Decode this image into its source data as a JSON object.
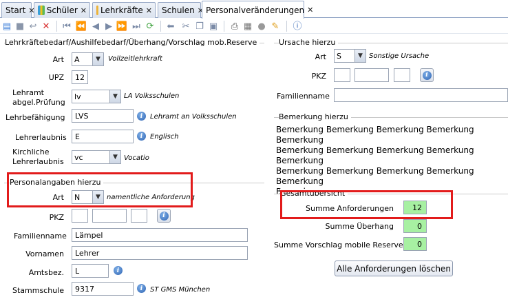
{
  "tabs": [
    {
      "label": "Start",
      "close": "✕"
    },
    {
      "label": "Schüler",
      "close": "✕"
    },
    {
      "label": "Lehrkräfte",
      "close": "✕"
    },
    {
      "label": "Schulen",
      "close": "✕"
    },
    {
      "label": "Personalveränderungen",
      "close": "✕"
    }
  ],
  "toolbar": {
    "icons": [
      "new-icon",
      "save-icon",
      "undo-icon",
      "delete-icon",
      "first-icon",
      "prev-page-icon",
      "prev-icon",
      "next-icon",
      "next-page-icon",
      "last-icon",
      "refresh-icon",
      "back-icon",
      "cut-icon",
      "copy-icon",
      "paste-icon",
      "print-icon",
      "preview-icon",
      "record-icon",
      "clear-icon",
      "help-icon"
    ]
  },
  "left": {
    "legend": "Lehrkräftebedarf/Aushilfebedarf/Überhang/Vorschlag mob.Reserve",
    "art": {
      "label": "Art",
      "value": "A",
      "desc": "Vollzeitlehrkraft"
    },
    "upz": {
      "label": "UPZ",
      "value": "12"
    },
    "lehramt": {
      "label1": "Lehramt",
      "label2": "abgel.Prüfung",
      "value": "lv",
      "desc": "LA Volksschulen"
    },
    "befaehigung": {
      "label": "Lehrbefähigung",
      "value": "LVS",
      "desc": "Lehramt an Volksschulen"
    },
    "erlaubnis": {
      "label": "Lehrerlaubnis",
      "value": "E",
      "desc": "Englisch"
    },
    "kirchlich": {
      "label1": "Kirchliche",
      "label2": "Lehrerlaubnis",
      "value": "vc",
      "desc": "Vocatio"
    }
  },
  "personal": {
    "legend": "Personalangaben hierzu",
    "art": {
      "label": "Art",
      "value": "N",
      "desc": "namentliche Anforderung"
    },
    "pkz": {
      "label": "PKZ"
    },
    "familienname": {
      "label": "Familienname",
      "value": "Lämpel"
    },
    "vornamen": {
      "label": "Vornamen",
      "value": "Lehrer"
    },
    "amtsbez": {
      "label": "Amtsbez.",
      "value": "L"
    },
    "stammschule": {
      "label": "Stammschule",
      "value": "9317",
      "desc": "ST GMS München"
    }
  },
  "ursache": {
    "legend": "Ursache hierzu",
    "art": {
      "label": "Art",
      "value": "S",
      "desc": "Sonstige Ursache"
    },
    "pkz": {
      "label": "PKZ"
    },
    "familienname": {
      "label": "Familienname"
    }
  },
  "bemerkung": {
    "legend": "Bemerkung hierzu",
    "text": "Bemerkung Bemerkung Bemerkung Bemerkung Bemerkung\nBemerkung Bemerkung Bemerkung Bemerkung Bemerkung\nBemerkung Bemerkung Bemerkung Bemerkung Bemerkung\nBemerkung"
  },
  "gesamt": {
    "legend": "Gesamtübersicht",
    "anforderungen": {
      "label": "Summe Anforderungen",
      "value": "12"
    },
    "ueberhang": {
      "label": "Summe Überhang",
      "value": "0"
    },
    "reserve": {
      "label": "Summe Vorschlag mobile Reserve",
      "value": "0"
    },
    "button": "Alle Anforderungen löschen"
  },
  "colors": {
    "highlight": "#e21b1b",
    "sum_field": "#a7f0a2",
    "tab_border": "#8ea2c4"
  }
}
